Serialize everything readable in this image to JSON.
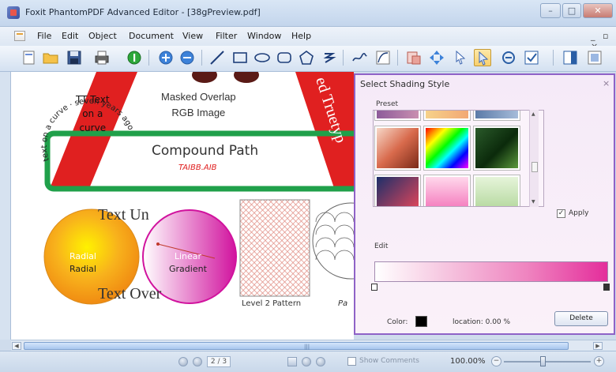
{
  "window": {
    "title": "Foxit PhantomPDF Advanced Editor - [38gPreview.pdf]",
    "minimize": "–",
    "maximize": "□",
    "close": "✕"
  },
  "menu": {
    "items": [
      "File",
      "Edit",
      "Object",
      "Document",
      "View",
      "Filter",
      "Window",
      "Help"
    ],
    "mdi_controls": "_ ▫ ×"
  },
  "toolbar": {
    "icons": [
      "new-document-icon",
      "open-folder-icon",
      "save-icon",
      "print-icon",
      "info-icon",
      "zoom-in-icon",
      "zoom-out-icon",
      "line-tool-icon",
      "rectangle-tool-icon",
      "ellipse-tool-icon",
      "rounded-rectangle-tool-icon",
      "polygon-tool-icon",
      "spiral-tool-icon",
      "freehand-tool-icon",
      "curve-tool-icon",
      "image-tool-icon",
      "move-tool-icon",
      "select-tool-icon",
      "shading-tool-icon",
      "no-entry-icon",
      "checkmark-icon",
      "panel-icon",
      "preview-icon"
    ]
  },
  "canvas": {
    "curve_text": "text on a curve · seven years ago",
    "tt_text": [
      "TT Text",
      "on a",
      "curve"
    ],
    "masked_overlap": [
      "Masked Overlap",
      "RGB Image"
    ],
    "banner_text": "ed Truetyp",
    "compound_path": "Compound Path",
    "compound_path_sub": "TAIBB.AIB",
    "text_under": "Text Un",
    "radial": [
      "Radial",
      "Radial"
    ],
    "linear": [
      "Linear",
      "Gradient"
    ],
    "text_over": "Text Over",
    "pattern_label": "Level 2 Pattern",
    "partial_label": "Pa"
  },
  "dialog": {
    "title": "Select Shading Style",
    "close": "×",
    "preset_label": "Preset",
    "apply_label": "Apply",
    "apply_checked": true,
    "edit_label": "Edit",
    "color_label": "Color:",
    "color_value": "#000000",
    "location_label": "location: 0.00  %",
    "delete_label": "Delete",
    "accent": "#8f62c7"
  },
  "statusbar": {
    "page": "2 / 3",
    "show_comments": "Show Comments",
    "zoom": "100.00%"
  }
}
